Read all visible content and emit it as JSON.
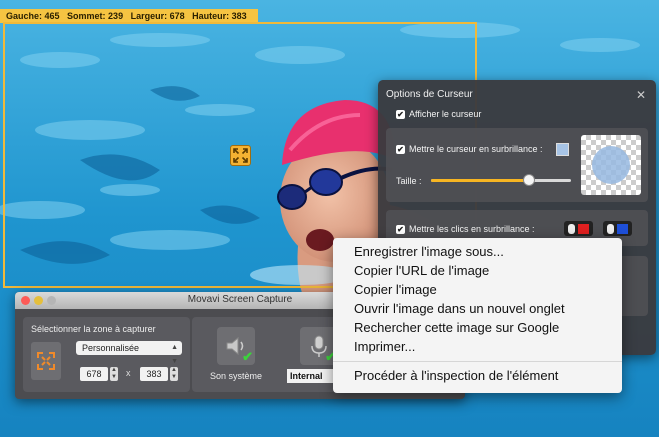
{
  "selection": {
    "left_label": "Gauche: 465",
    "top_label": "Sommet: 239",
    "width_label": "Largeur: 678",
    "height_label": "Hauteur: 383"
  },
  "cursor_panel": {
    "title": "Options de Curseur",
    "show_cursor": "Afficher le curseur",
    "highlight_cursor": "Mettre le curseur en surbrillance :",
    "size_label": "Taille :",
    "size_level": 0.7,
    "highlight_clicks": "Mettre les clics en surbrillance :",
    "highlight_color": "#a7c4e6",
    "left_click_color": "#e02020",
    "right_click_color": "#1e4fd8"
  },
  "movavi": {
    "title": "Movavi Screen Capture",
    "area_label": "Sélectionner la zone à capturer",
    "preset": "Personnalisée",
    "width_value": "678",
    "times": "x",
    "height_value": "383",
    "system_audio_label": "Son système",
    "mic_value": "Internal"
  },
  "context_menu": {
    "items": [
      "Enregistrer l'image sous...",
      "Copier l'URL de l'image",
      "Copier l'image",
      "Ouvrir l'image dans un nouvel onglet",
      "Rechercher cette image sur Google",
      "Imprimer..."
    ],
    "inspect": "Procéder à l'inspection de l'élément"
  },
  "icons": {
    "resize": "expand-arrows-icon",
    "close": "close-icon",
    "speaker": "speaker-icon",
    "microphone": "microphone-icon",
    "area": "crop-area-icon"
  }
}
